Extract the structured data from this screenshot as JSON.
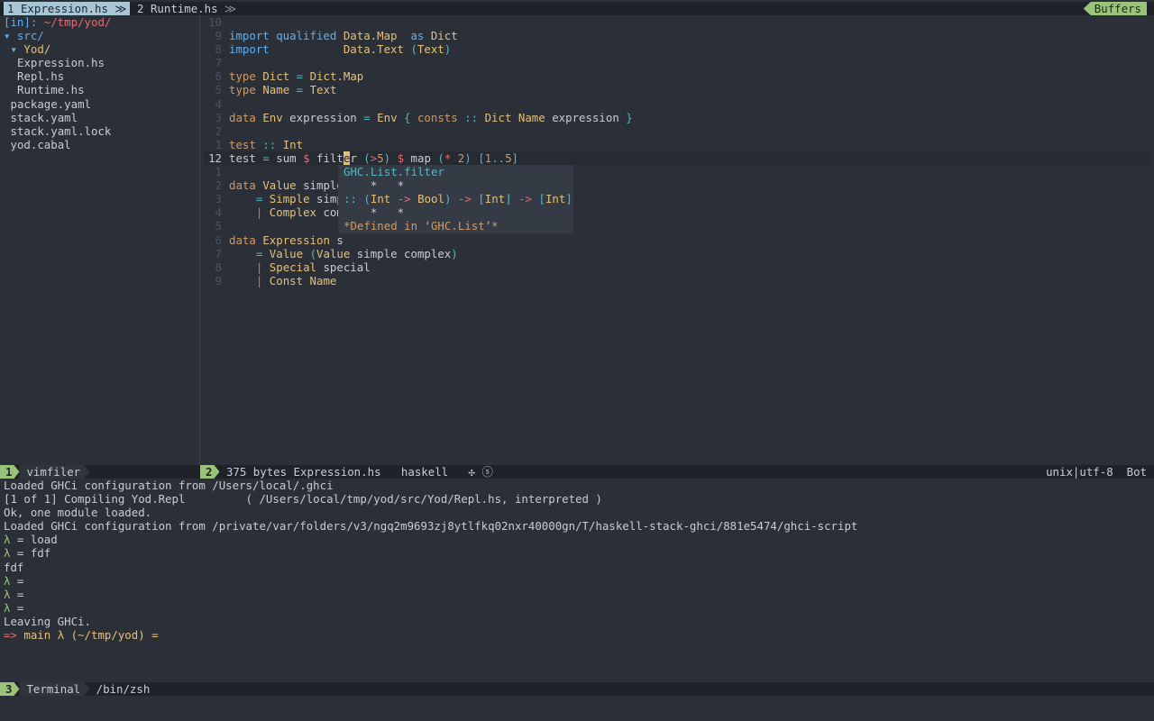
{
  "tabline": {
    "tab1_num": "1",
    "tab1_name": "Expression.hs",
    "tab_sep": "≫",
    "tab2_num": "2",
    "tab2_name": "Runtime.hs",
    "buffers_label": "Buffers"
  },
  "filer": {
    "header_prefix": "[in]: ",
    "header_path": "~/tmp/yod/",
    "items": [
      {
        "indent": 0,
        "mark": "▾ ",
        "name": "src/",
        "type": "dir"
      },
      {
        "indent": 1,
        "mark": "▾ ",
        "name": "Yod/",
        "type": "dir"
      },
      {
        "indent": 2,
        "mark": "",
        "name": "Expression.hs",
        "type": "file"
      },
      {
        "indent": 2,
        "mark": "",
        "name": "Repl.hs",
        "type": "file"
      },
      {
        "indent": 2,
        "mark": "",
        "name": "Runtime.hs",
        "type": "file"
      },
      {
        "indent": 1,
        "mark": "",
        "name": "package.yaml",
        "type": "file"
      },
      {
        "indent": 1,
        "mark": "",
        "name": "stack.yaml",
        "type": "file"
      },
      {
        "indent": 1,
        "mark": "",
        "name": "stack.yaml.lock",
        "type": "file"
      },
      {
        "indent": 1,
        "mark": "",
        "name": "yod.cabal",
        "type": "file"
      }
    ]
  },
  "editor": {
    "lines": [
      {
        "n": "10",
        "code": []
      },
      {
        "n": "9",
        "code": [
          [
            "blue",
            "import qualified "
          ],
          [
            "yellow",
            "Data.Map"
          ],
          [
            "white",
            "  "
          ],
          [
            "blue",
            "as "
          ],
          [
            "yellow",
            "Dict"
          ]
        ]
      },
      {
        "n": "8",
        "code": [
          [
            "blue",
            "import           "
          ],
          [
            "yellow",
            "Data.Text "
          ],
          [
            "cyan",
            "("
          ],
          [
            "yellow",
            "Text"
          ],
          [
            "cyan",
            ")"
          ]
        ]
      },
      {
        "n": "7",
        "code": []
      },
      {
        "n": "6",
        "code": [
          [
            "orange",
            "type "
          ],
          [
            "yellow",
            "Dict"
          ],
          [
            "white",
            " "
          ],
          [
            "cyan",
            "="
          ],
          [
            "white",
            " "
          ],
          [
            "yellow",
            "Dict.Map"
          ]
        ]
      },
      {
        "n": "5",
        "code": [
          [
            "orange",
            "type "
          ],
          [
            "yellow",
            "Name"
          ],
          [
            "white",
            " "
          ],
          [
            "cyan",
            "="
          ],
          [
            "white",
            " "
          ],
          [
            "yellow",
            "Text"
          ]
        ]
      },
      {
        "n": "4",
        "code": []
      },
      {
        "n": "3",
        "code": [
          [
            "orange",
            "data "
          ],
          [
            "yellow",
            "Env"
          ],
          [
            "white",
            " expression "
          ],
          [
            "cyan",
            "="
          ],
          [
            "white",
            " "
          ],
          [
            "yellow",
            "Env"
          ],
          [
            "white",
            " "
          ],
          [
            "cyan",
            "{"
          ],
          [
            "white",
            " "
          ],
          [
            "orange",
            "consts"
          ],
          [
            "white",
            " "
          ],
          [
            "cyan",
            "::"
          ],
          [
            "white",
            " "
          ],
          [
            "yellow",
            "Dict Name"
          ],
          [
            "white",
            " expression "
          ],
          [
            "cyan",
            "}"
          ]
        ]
      },
      {
        "n": "2",
        "code": []
      },
      {
        "n": "1",
        "code": [
          [
            "orange",
            "test"
          ],
          [
            "white",
            " "
          ],
          [
            "cyan",
            "::"
          ],
          [
            "white",
            " "
          ],
          [
            "yellow",
            "Int"
          ]
        ]
      },
      {
        "n": "12",
        "current": true,
        "code": [
          [
            "white",
            "test "
          ],
          [
            "cyan",
            "="
          ],
          [
            "white",
            " sum "
          ],
          [
            "red",
            "$"
          ],
          [
            "white",
            " filt"
          ],
          [
            "cursor",
            "e"
          ],
          [
            "white",
            "r "
          ],
          [
            "cyan",
            "("
          ],
          [
            "red",
            ">"
          ],
          [
            "orange",
            "5"
          ],
          [
            "cyan",
            ")"
          ],
          [
            "white",
            " "
          ],
          [
            "red",
            "$"
          ],
          [
            "white",
            " map "
          ],
          [
            "cyan",
            "("
          ],
          [
            "red",
            "*"
          ],
          [
            "white",
            " "
          ],
          [
            "orange",
            "2"
          ],
          [
            "cyan",
            ")"
          ],
          [
            "white",
            " "
          ],
          [
            "cyan",
            "["
          ],
          [
            "orange",
            "1"
          ],
          [
            "cyan",
            ".."
          ],
          [
            "orange",
            "5"
          ],
          [
            "cyan",
            "]"
          ]
        ]
      },
      {
        "n": "1",
        "code": []
      },
      {
        "n": "2",
        "code": [
          [
            "orange",
            "data "
          ],
          [
            "yellow",
            "Value"
          ],
          [
            "white",
            " simple"
          ]
        ]
      },
      {
        "n": "3",
        "code": [
          [
            "white",
            "    "
          ],
          [
            "cyan",
            "="
          ],
          [
            "white",
            " "
          ],
          [
            "yellow",
            "Simple"
          ],
          [
            "white",
            " simp"
          ]
        ]
      },
      {
        "n": "4",
        "code": [
          [
            "white",
            "    "
          ],
          [
            "red",
            "|"
          ],
          [
            "white",
            " "
          ],
          [
            "yellow",
            "Complex"
          ],
          [
            "white",
            " com"
          ]
        ]
      },
      {
        "n": "5",
        "code": []
      },
      {
        "n": "6",
        "code": [
          [
            "orange",
            "data "
          ],
          [
            "yellow",
            "Expression"
          ],
          [
            "white",
            " s"
          ]
        ]
      },
      {
        "n": "7",
        "code": [
          [
            "white",
            "    "
          ],
          [
            "cyan",
            "="
          ],
          [
            "white",
            " "
          ],
          [
            "yellow",
            "Value"
          ],
          [
            "white",
            " "
          ],
          [
            "cyan",
            "("
          ],
          [
            "yellow",
            "Value"
          ],
          [
            "white",
            " simple complex"
          ],
          [
            "cyan",
            ")"
          ]
        ]
      },
      {
        "n": "8",
        "code": [
          [
            "white",
            "    "
          ],
          [
            "red",
            "|"
          ],
          [
            "white",
            " "
          ],
          [
            "yellow",
            "Special"
          ],
          [
            "white",
            " special"
          ]
        ]
      },
      {
        "n": "9",
        "code": [
          [
            "white",
            "    "
          ],
          [
            "red",
            "|"
          ],
          [
            "white",
            " "
          ],
          [
            "yellow",
            "Const Name"
          ]
        ]
      }
    ]
  },
  "popup": {
    "lines": [
      [
        [
          "cyan",
          "GHC.List.filter"
        ]
      ],
      [
        [
          "white",
          "    *   *"
        ]
      ],
      [
        [
          "cyan",
          ":: "
        ],
        [
          "cyan",
          "("
        ],
        [
          "yellow",
          "Int"
        ],
        [
          "white",
          " "
        ],
        [
          "red",
          "->"
        ],
        [
          "white",
          " "
        ],
        [
          "yellow",
          "Bool"
        ],
        [
          "cyan",
          ")"
        ],
        [
          "white",
          " "
        ],
        [
          "red",
          "->"
        ],
        [
          "white",
          " "
        ],
        [
          "cyan",
          "["
        ],
        [
          "yellow",
          "Int"
        ],
        [
          "cyan",
          "]"
        ],
        [
          "white",
          " "
        ],
        [
          "red",
          "->"
        ],
        [
          "white",
          " "
        ],
        [
          "cyan",
          "["
        ],
        [
          "yellow",
          "Int"
        ],
        [
          "cyan",
          "]"
        ]
      ],
      [
        [
          "white",
          "    *   *"
        ]
      ],
      [
        [
          "orange",
          "*Defined in ‘GHC.List’*"
        ]
      ]
    ]
  },
  "status_filer": {
    "num": "1",
    "name": "vimfiler"
  },
  "status_editor": {
    "num": "2",
    "size": "375 bytes",
    "file": "Expression.hs",
    "filetype": "haskell",
    "icons": "✣ ⓢ",
    "encoding": "unix|utf-8",
    "position": "Bot"
  },
  "terminal": {
    "lines": [
      [
        [
          "white",
          "Loaded GHCi configuration from /Users/local/.ghci"
        ]
      ],
      [
        [
          "white",
          "[1 of 1] Compiling Yod.Repl         ( /Users/local/tmp/yod/src/Yod/Repl.hs, interpreted )"
        ]
      ],
      [
        [
          "white",
          "Ok, one module loaded."
        ]
      ],
      [
        [
          "white",
          "Loaded GHCi configuration from /private/var/folders/v3/ngq2m9693zj8ytlfkq02nxr40000gn/T/haskell-stack-ghci/881e5474/ghci-script"
        ]
      ],
      [
        [
          "green",
          "λ"
        ],
        [
          "white",
          " = load"
        ]
      ],
      [
        [
          "green",
          "λ"
        ],
        [
          "white",
          " = fdf"
        ]
      ],
      [
        [
          "white",
          "fdf"
        ]
      ],
      [
        [
          "green",
          "λ"
        ],
        [
          "white",
          " ="
        ]
      ],
      [
        [
          "green",
          "λ"
        ],
        [
          "white",
          " ="
        ]
      ],
      [
        [
          "green",
          "λ"
        ],
        [
          "white",
          " ="
        ]
      ],
      [
        [
          "white",
          "Leaving GHCi."
        ]
      ],
      [
        [
          "red",
          "=> "
        ],
        [
          "yellow",
          "main λ (~/tmp/yod) ="
        ]
      ]
    ]
  },
  "status_terminal": {
    "num": "3",
    "name": "Terminal",
    "shell": "/bin/zsh"
  }
}
